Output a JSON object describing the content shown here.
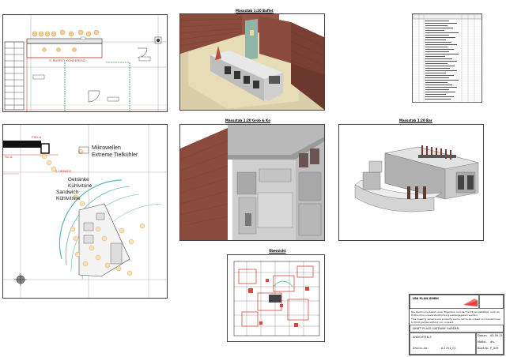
{
  "sheet": {
    "background": "#ffffff"
  },
  "views": {
    "buffet": {
      "title": "Massstab 1:20 Buffet"
    },
    "kitchen": {
      "title": "Massstab 1:20 Grob & Ko"
    },
    "bar": {
      "title": "Massstab 1:20 Bar"
    },
    "overview": {
      "title": "Übersicht"
    }
  },
  "plan_bottom": {
    "labels": {
      "microwave": "Mikrowellen",
      "freezer": "Extreme Tiefkühler",
      "drinks": "Getränke",
      "drinks2": "Kühlvitrine",
      "sandwich": "Sandwich",
      "sandwich2": "Kühlvitrine",
      "fsd": "FSD-A",
      "sup": "SU-A",
      "drawings": "S. DRAWGS"
    }
  },
  "plan_top": {
    "labels": {
      "buffet_note": "S. BUFFET KONFERENZ"
    }
  },
  "title_block": {
    "company": "UNI PLAN GMBH",
    "note_de": "Die Zeichnung bleibt unser Eigentum und darf nicht vervielfältigt, noch an Dritte ohne unsere Zustimmung weitergegeben werden.",
    "note_en": "This drawing remains our property and is not to be copied nor handed over to third parties without our consent.",
    "project": "HYATT PLACE GATEWAY GARDEN",
    "drawing_label": "ANSICHTEN 3",
    "number_label": "Zeichn.-Nr.:",
    "number": "A-1701_01",
    "date_label": "Datum",
    "date_value": "03.09.15",
    "scale_label": "Maßst.",
    "scale_value": "div.",
    "sheet_label": "Blatt-Nr.",
    "sheet_value": "P_005",
    "accent": "#e8423c"
  },
  "colors": {
    "wall_brick": "#8a4a3c",
    "counter_grey": "#cfcfcf",
    "teal_line": "#5fb7b0",
    "orange_marker": "#e8a24a",
    "red_line": "#d6483c"
  }
}
